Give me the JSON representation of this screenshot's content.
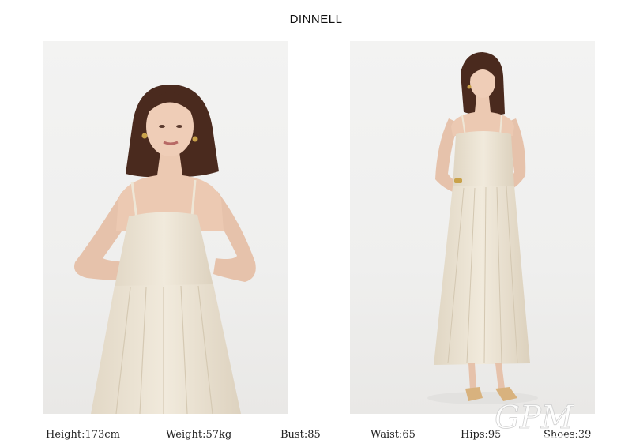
{
  "brand": "DINNELL",
  "photos": [
    {
      "subject": "model-waist-up-cream-linen-dress"
    },
    {
      "subject": "model-full-length-cream-linen-dress"
    }
  ],
  "measurements": {
    "height": "Height:173cm",
    "weight": "Weight:57kg",
    "bust": "Bust:85",
    "waist": "Waist:65",
    "hips": "Hips:95",
    "shoes": "Shoes:39"
  },
  "watermark": "GPM",
  "colors": {
    "background": "#ffffff",
    "studio": "#f0f0ef",
    "dress": "#ece4d4",
    "skin": "#e8c4ae",
    "hair": "#4a2a1e"
  }
}
